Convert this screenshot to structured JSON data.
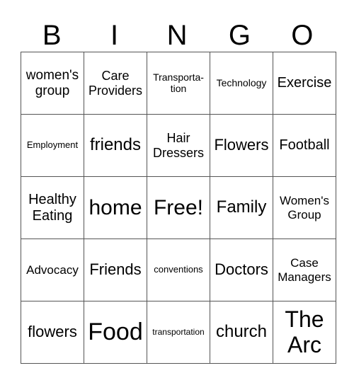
{
  "header": [
    "B",
    "I",
    "N",
    "G",
    "O"
  ],
  "rows": [
    [
      "women's group",
      "Care Providers",
      "Transporta-tion",
      "Technology",
      "Exercise"
    ],
    [
      "Employment",
      "friends",
      "Hair Dressers",
      "Flowers",
      "Football"
    ],
    [
      "Healthy Eating",
      "home",
      "Free!",
      "Family",
      "Women's Group"
    ],
    [
      "Advocacy",
      "Friends",
      "conventions",
      "Doctors",
      "Case Managers"
    ],
    [
      "flowers",
      "Food",
      "transportation",
      "church",
      "The Arc"
    ]
  ]
}
